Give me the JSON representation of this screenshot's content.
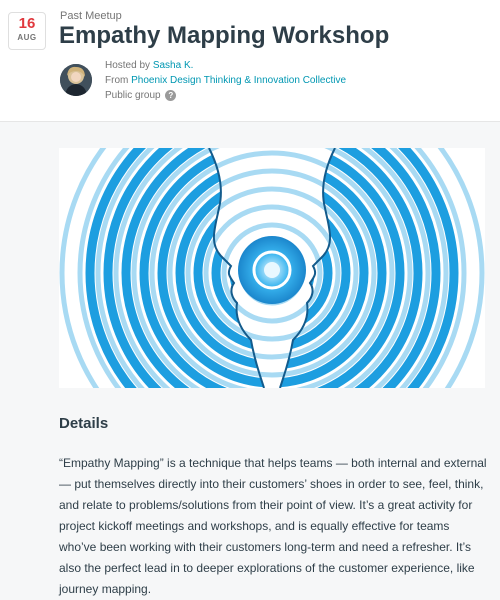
{
  "event": {
    "date": {
      "day": "16",
      "month": "AUG"
    },
    "status": "Past Meetup",
    "title": "Empathy Mapping Workshop"
  },
  "host": {
    "prefix": "Hosted by ",
    "name": "Sasha K.",
    "from_prefix": "From ",
    "group": "Phoenix Design Thinking & Innovation Collective",
    "visibility": "Public group",
    "help_icon": "?"
  },
  "hero_image": {
    "icon": "two-profiles-facing-ripple-illustration"
  },
  "details": {
    "heading": "Details",
    "body": "“Empathy Mapping” is a technique that helps teams — both internal and external — put themselves directly into their customers’ shoes in order to see, feel, think, and relate to problems/solutions from their point of view. It’s a great activity for project kickoff meetings and workshops, and is equally effective for teams who’ve been working with their customers long-term and need a refresher. It’s also the perfect lead in to deeper explorations of the customer experience, like journey mapping."
  },
  "colors": {
    "accent_red": "#e0393e",
    "link_teal": "#0097b2",
    "ripple_blue": "#1da1e2"
  }
}
